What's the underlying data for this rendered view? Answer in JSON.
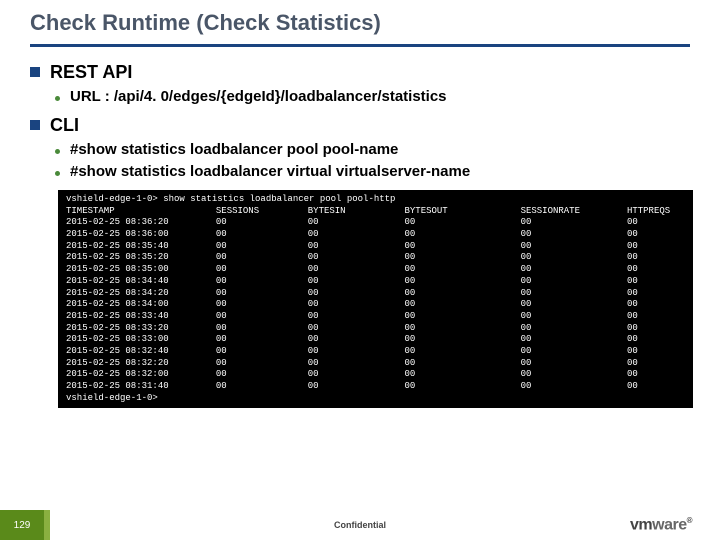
{
  "title": "Check Runtime (Check Statistics)",
  "sections": [
    {
      "title": "REST API",
      "items": [
        "URL : /api/4. 0/edges/{edgeId}/loadbalancer/statistics"
      ]
    },
    {
      "title": "CLI",
      "items": [
        "#show statistics loadbalancer pool pool-name",
        "#show statistics loadbalancer virtual virtualserver-name"
      ]
    }
  ],
  "terminal": {
    "prompt1": "vshield-edge-1-0> show statistics loadbalancer pool pool-http",
    "headers": [
      "TIMESTAMP",
      "SESSIONS",
      "BYTESIN",
      "BYTESOUT",
      "SESSIONRATE",
      "HTTPREQS"
    ],
    "rows": [
      [
        "2015-02-25 08:36:20",
        "00",
        "00",
        "00",
        "00",
        "00"
      ],
      [
        "2015-02-25 08:36:00",
        "00",
        "00",
        "00",
        "00",
        "00"
      ],
      [
        "2015-02-25 08:35:40",
        "00",
        "00",
        "00",
        "00",
        "00"
      ],
      [
        "2015-02-25 08:35:20",
        "00",
        "00",
        "00",
        "00",
        "00"
      ],
      [
        "2015-02-25 08:35:00",
        "00",
        "00",
        "00",
        "00",
        "00"
      ],
      [
        "2015-02-25 08:34:40",
        "00",
        "00",
        "00",
        "00",
        "00"
      ],
      [
        "2015-02-25 08:34:20",
        "00",
        "00",
        "00",
        "00",
        "00"
      ],
      [
        "2015-02-25 08:34:00",
        "00",
        "00",
        "00",
        "00",
        "00"
      ],
      [
        "2015-02-25 08:33:40",
        "00",
        "00",
        "00",
        "00",
        "00"
      ],
      [
        "2015-02-25 08:33:20",
        "00",
        "00",
        "00",
        "00",
        "00"
      ],
      [
        "2015-02-25 08:33:00",
        "00",
        "00",
        "00",
        "00",
        "00"
      ],
      [
        "2015-02-25 08:32:40",
        "00",
        "00",
        "00",
        "00",
        "00"
      ],
      [
        "2015-02-25 08:32:20",
        "00",
        "00",
        "00",
        "00",
        "00"
      ],
      [
        "2015-02-25 08:32:00",
        "00",
        "00",
        "00",
        "00",
        "00"
      ],
      [
        "2015-02-25 08:31:40",
        "00",
        "00",
        "00",
        "00",
        "00"
      ]
    ],
    "prompt2": "vshield-edge-1-0>"
  },
  "footer": {
    "page": "129",
    "confidential": "Confidential",
    "logo": "vmware"
  }
}
